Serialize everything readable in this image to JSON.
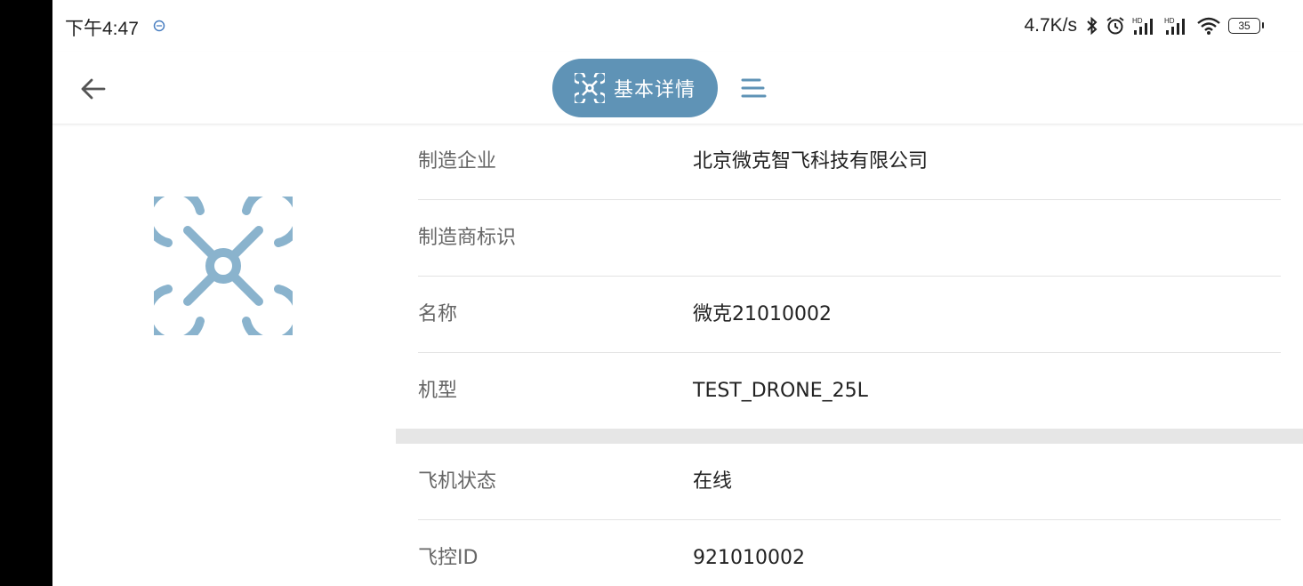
{
  "status_bar": {
    "time": "下午4:47",
    "net_speed": "4.7K/s",
    "battery": "35",
    "icons": [
      "bluetooth-icon",
      "alarm-icon",
      "signal-hd-icon",
      "signal-hd-icon",
      "wifi-icon",
      "battery-icon"
    ]
  },
  "toolbar": {
    "back_icon": "back-arrow-icon",
    "title": "基本详情",
    "title_icon": "drone-icon",
    "menu_icon": "menu-icon"
  },
  "colors": {
    "accent": "#5f93b6",
    "drone_icon": "#8ab3cd",
    "label": "#666666",
    "value": "#222222"
  },
  "details": {
    "rows": [
      {
        "label": "制造企业",
        "value": "北京微克智飞科技有限公司"
      },
      {
        "label": "制造商标识",
        "value": ""
      },
      {
        "label": "名称",
        "value": "微克21010002"
      },
      {
        "label": "机型",
        "value": "TEST_DRONE_25L"
      }
    ],
    "status_rows": [
      {
        "label": "飞机状态",
        "value": "在线"
      },
      {
        "label": "飞控ID",
        "value": "921010002"
      }
    ]
  }
}
